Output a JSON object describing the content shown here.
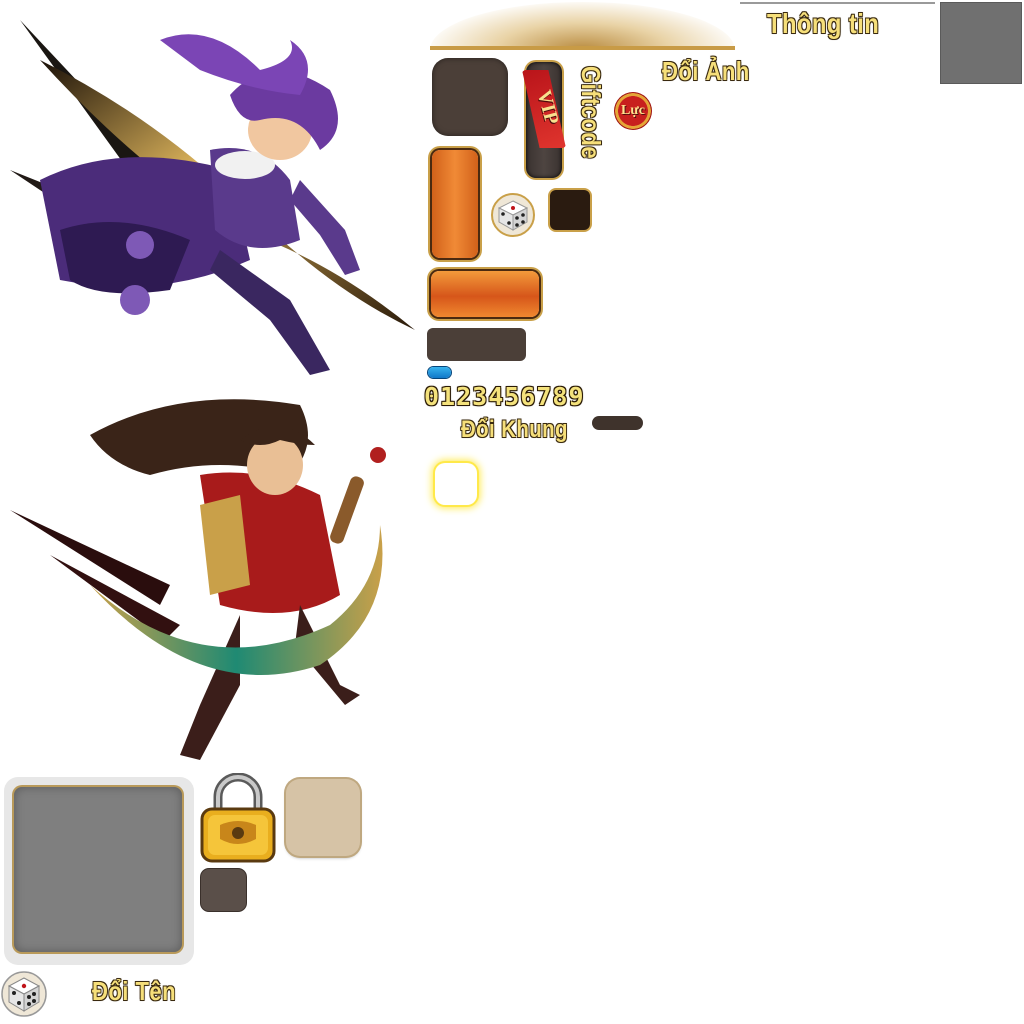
{
  "labels": {
    "info": "Thông tin",
    "change_avatar": "Đổi Ảnh",
    "giftcode": "Giftcode",
    "vip": "VIP",
    "power": "Lực",
    "digits": "0123456789",
    "change_frame": "Đổi Khung",
    "change_name": "Đổi Tên"
  },
  "icons": {
    "dice": "dice-icon",
    "lock": "lock-icon"
  },
  "colors": {
    "gold": "#f6df7a",
    "orange": "#ec7a2a",
    "dark_panel": "#4b3f38",
    "grey_panel": "#7f7f7f",
    "beige_panel": "#d6c3a6"
  }
}
